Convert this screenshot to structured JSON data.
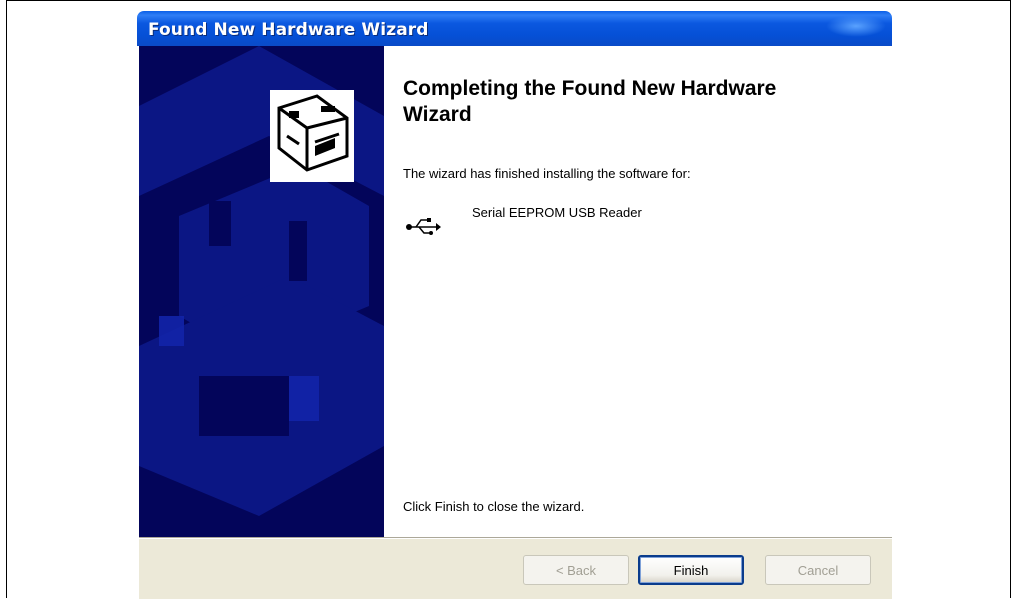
{
  "window": {
    "title": "Found New Hardware Wizard"
  },
  "content": {
    "heading": "Completing the Found New Hardware Wizard",
    "subtitle": "The wizard has finished installing the software for:",
    "device_name": "Serial EEPROM USB Reader",
    "device_icon": "usb-icon",
    "close_instruction": "Click Finish to close the wizard."
  },
  "buttons": {
    "back": "< Back",
    "finish": "Finish",
    "cancel": "Cancel"
  },
  "colors": {
    "titlebar": "#0550d6",
    "banner": "#03055a",
    "footer": "#ece9d8"
  }
}
